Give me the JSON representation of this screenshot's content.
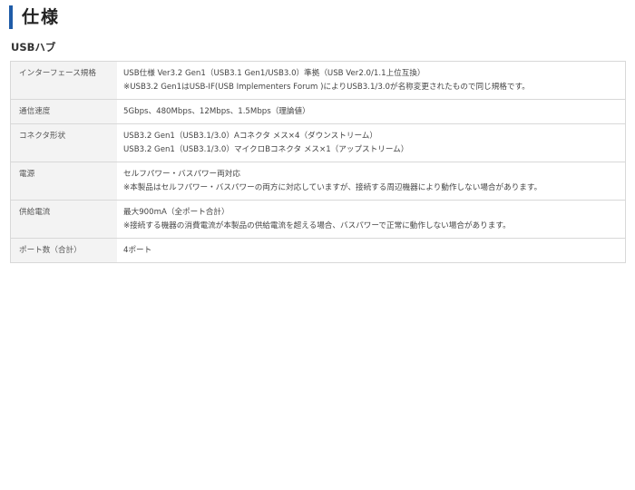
{
  "page": {
    "title": "仕様",
    "section": "USBハブ"
  },
  "specs": [
    {
      "label": "インターフェース規格",
      "lines": [
        "USB仕様 Ver3.2 Gen1（USB3.1 Gen1/USB3.0）準拠（USB Ver2.0/1.1上位互換）",
        "※USB3.2 Gen1はUSB-IF(USB Implementers Forum )によりUSB3.1/3.0が名称変更されたもので同じ規格です。"
      ]
    },
    {
      "label": "通信速度",
      "lines": [
        "5Gbps、480Mbps、12Mbps、1.5Mbps（理論値）"
      ]
    },
    {
      "label": "コネクタ形状",
      "lines": [
        "USB3.2 Gen1（USB3.1/3.0）Aコネクタ メス×4（ダウンストリーム）",
        "USB3.2 Gen1（USB3.1/3.0）マイクロBコネクタ メス×1（アップストリーム）"
      ]
    },
    {
      "label": "電源",
      "lines": [
        "セルフパワー・バスパワー両対応",
        "※本製品はセルフパワー・バスパワーの両方に対応していますが、接続する周辺機器により動作しない場合があります。"
      ]
    },
    {
      "label": "供給電流",
      "lines": [
        "最大900mA（全ポート合計）",
        "※接続する機器の消費電流が本製品の供給電流を超える場合、バスパワーで正常に動作しない場合があります。"
      ]
    },
    {
      "label": "ポート数（合計）",
      "lines": [
        "4ポート"
      ]
    }
  ]
}
